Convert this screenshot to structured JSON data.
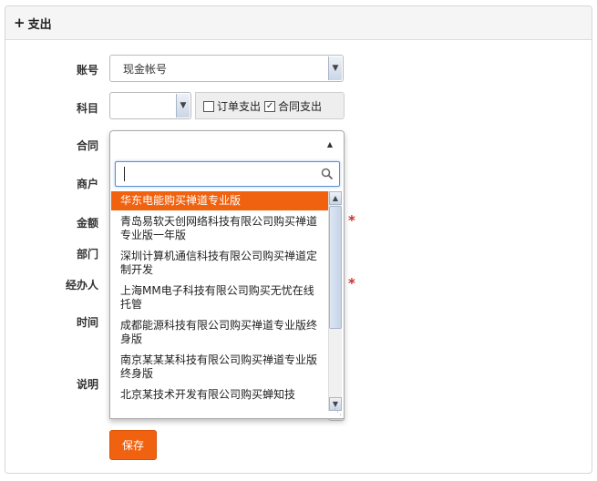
{
  "panel": {
    "title": "支出",
    "plus_icon": "+"
  },
  "labels": {
    "account": "账号",
    "subject": "科目",
    "contract": "合同",
    "merchant": "商户",
    "amount": "金额",
    "department": "部门",
    "handler": "经办人",
    "time": "时间",
    "note": "说明"
  },
  "account_select": {
    "value": "现金帐号"
  },
  "subject_select": {
    "value": ""
  },
  "checkboxes": {
    "order_expense": {
      "label": "订单支出",
      "checked": false
    },
    "contract_expense": {
      "label": "合同支出",
      "checked": true
    }
  },
  "contract_dropdown": {
    "search_value": "",
    "options": [
      {
        "label": "华东电能购买禅道专业版",
        "highlighted": true
      },
      {
        "label": "青岛易软天创网络科技有限公司购买禅道专业版一年版"
      },
      {
        "label": "深圳计算机通信科技有限公司购买禅道定制开发"
      },
      {
        "label": "上海MM电子科技有限公司购买无忧在线托管"
      },
      {
        "label": "成都能源科技有限公司购买禅道专业版终身版"
      },
      {
        "label": "南京某某某科技有限公司购买禅道专业版终身版"
      },
      {
        "label": "北京某技术开发有限公司购买蝉知技"
      }
    ]
  },
  "required_mark": "*",
  "save_label": "保存",
  "colors": {
    "accent": "#f0620f",
    "required": "#c9302c"
  }
}
